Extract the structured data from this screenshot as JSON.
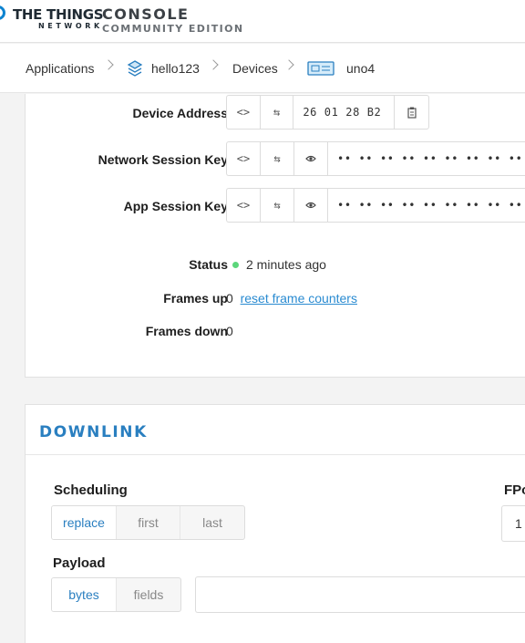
{
  "header": {
    "logo_main": "THE THINGS",
    "logo_sub": "NETWORK",
    "console_title": "CONSOLE",
    "console_sub": "COMMUNITY EDITION"
  },
  "breadcrumb": {
    "items": [
      {
        "label": "Applications"
      },
      {
        "label": "hello123",
        "icon": "layers-icon"
      },
      {
        "label": "Devices"
      },
      {
        "label": "uno4",
        "icon": "device-icon"
      }
    ]
  },
  "device": {
    "device_address": {
      "label": "Device Address",
      "value": "26 01 28 B2"
    },
    "network_session_key": {
      "label": "Network Session Key",
      "value": "•• •• •• •• •• •• •• •• •• ••"
    },
    "app_session_key": {
      "label": "App Session Key",
      "value": "•• •• •• •• •• •• •• •• •• ••"
    },
    "status": {
      "label": "Status",
      "value": "2 minutes ago",
      "color": "#5cd67b"
    },
    "frames_up": {
      "label": "Frames up",
      "value": "0",
      "link": "reset frame counters"
    },
    "frames_down": {
      "label": "Frames down",
      "value": "0"
    }
  },
  "downlink": {
    "title": "DOWNLINK",
    "scheduling": {
      "label": "Scheduling",
      "options": [
        "replace",
        "first",
        "last"
      ],
      "selected": "replace"
    },
    "fport": {
      "label": "FPo",
      "value": "1"
    },
    "payload": {
      "label": "Payload",
      "options": [
        "bytes",
        "fields"
      ],
      "selected": "bytes"
    }
  },
  "colors": {
    "accent": "#2a7fc0",
    "link": "#2a8bd1",
    "status_ok": "#5cd67b"
  }
}
